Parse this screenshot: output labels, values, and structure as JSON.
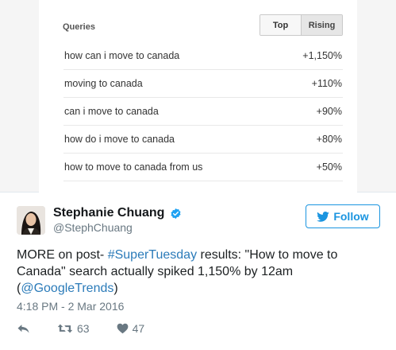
{
  "trends": {
    "header": "Queries",
    "toggle": {
      "top": "Top",
      "rising": "Rising",
      "selected": "Rising"
    },
    "rows": [
      {
        "query": "how can i move to canada",
        "change": "+1,150%"
      },
      {
        "query": "moving to canada",
        "change": "+110%"
      },
      {
        "query": "can i move to canada",
        "change": "+90%"
      },
      {
        "query": "how do i move to canada",
        "change": "+80%"
      },
      {
        "query": "how to move to canada from us",
        "change": "+50%"
      }
    ]
  },
  "tweet": {
    "author_name": "Stephanie Chuang",
    "handle": "@StephChuang",
    "follow_label": "Follow",
    "text_parts": {
      "p1": "MORE on post- ",
      "hashtag": "#SuperTuesday",
      "p2": " results: \"How to move to Canada\" search actually spiked 1,150% by 12am (",
      "mention": "@GoogleTrends",
      "p3": ")"
    },
    "timestamp": "4:18 PM - 2 Mar 2016",
    "retweets": "63",
    "likes": "47"
  },
  "colors": {
    "accent": "#1b95e0",
    "link": "#2b7bb9",
    "muted": "#697882"
  },
  "icons": [
    "verified-icon",
    "twitter-bird-icon",
    "reply-icon",
    "retweet-icon",
    "heart-icon"
  ]
}
